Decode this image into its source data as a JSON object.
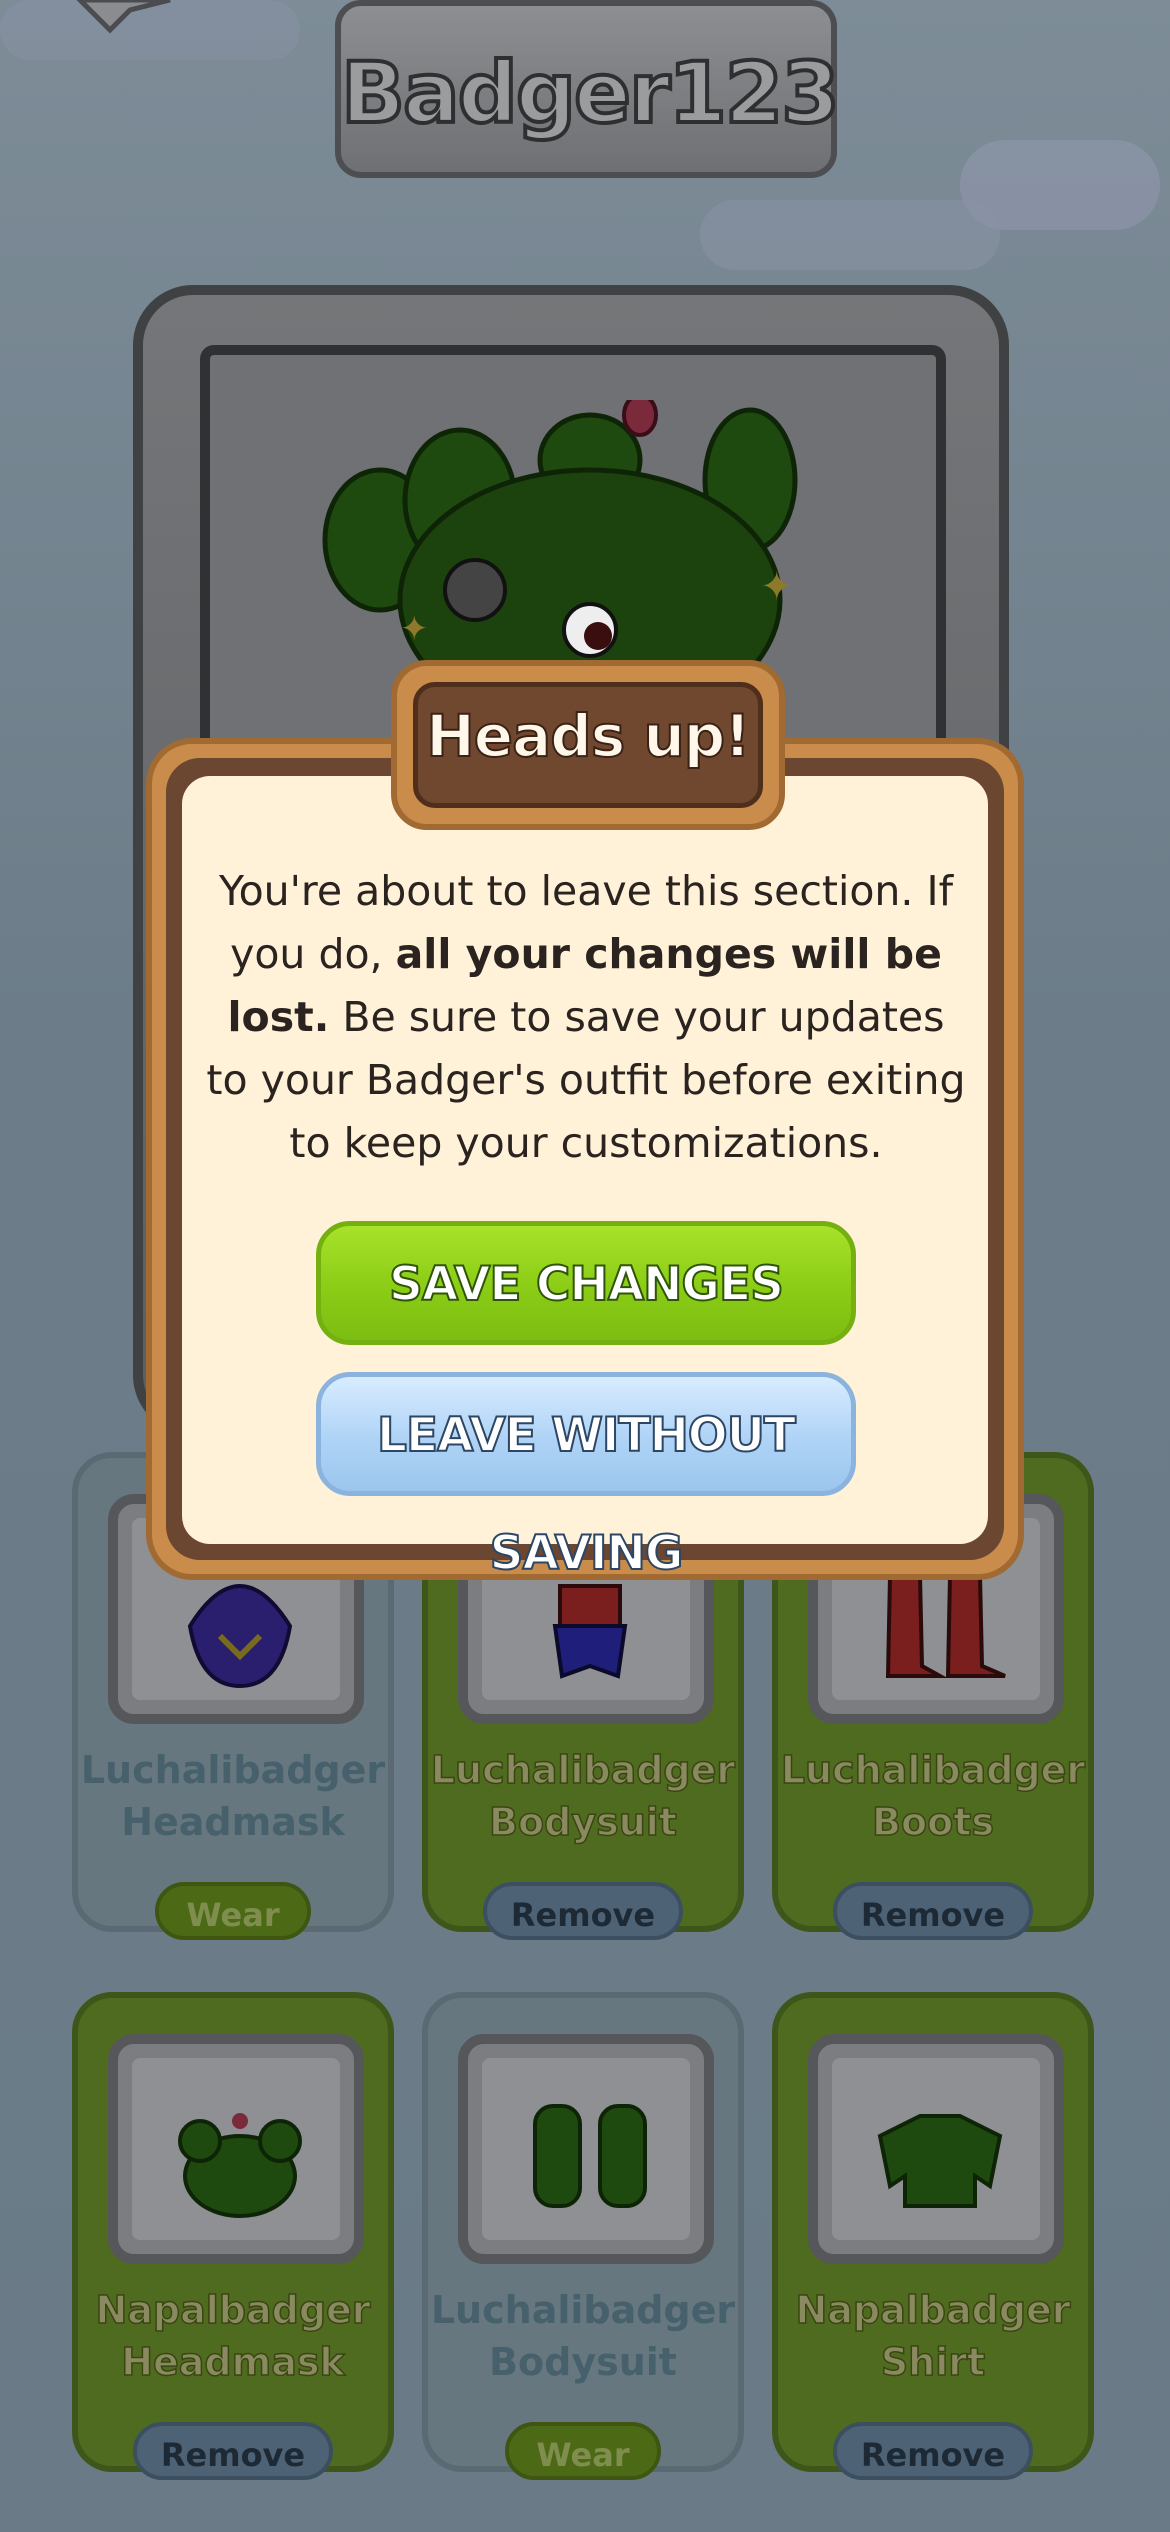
{
  "header": {
    "username": "Badger123"
  },
  "modal": {
    "title": "Heads up!",
    "message_part1": "You're about to leave this section. If you do, ",
    "message_bold": "all your changes will be lost.",
    "message_part2": " Be sure to save your updates to your Badger's outfit before exiting to keep your customizations.",
    "save_label": "SAVE CHANGES",
    "leave_label": "LEAVE WITHOUT SAVING"
  },
  "items": [
    {
      "name": "Luchalibadger Headmask",
      "action": "Wear",
      "equipped": false
    },
    {
      "name": "Luchalibadger Bodysuit",
      "action": "Remove",
      "equipped": true
    },
    {
      "name": "Luchalibadger Boots",
      "action": "Remove",
      "equipped": true
    },
    {
      "name": "Napalbadger Headmask",
      "action": "Remove",
      "equipped": true
    },
    {
      "name": "Luchalibadger Bodysuit",
      "action": "Wear",
      "equipped": false
    },
    {
      "name": "Napalbadger Shirt",
      "action": "Remove",
      "equipped": true
    }
  ],
  "icons": {
    "back": "back-arrow-icon",
    "avatar": "cactus-badger-avatar",
    "sparkles": "sparkle-icon"
  },
  "colors": {
    "save_button": "#8bcc16",
    "leave_button": "#aed3f6",
    "modal_paper": "#fff2d8",
    "modal_frame": "#c98c4a",
    "equipped_card": "#4f6b1f",
    "unequipped_card": "#67777f"
  }
}
